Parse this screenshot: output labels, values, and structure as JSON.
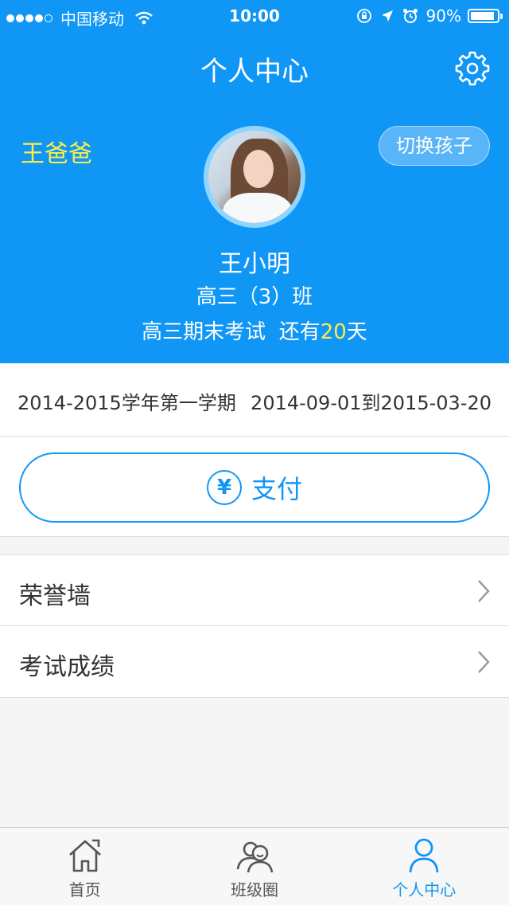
{
  "status_bar": {
    "carrier": "中国移动",
    "time": "10:00",
    "battery_text": "90%",
    "battery_level": 0.9,
    "icons": [
      "signal-dots-icon",
      "wifi-icon",
      "orientation-lock-icon",
      "location-arrow-icon",
      "alarm-icon",
      "battery-icon"
    ]
  },
  "header": {
    "title": "个人中心",
    "settings_icon": "gear-icon",
    "parent_name": "王爸爸",
    "switch_child_label": "切换孩子",
    "child_name": "王小明",
    "child_class": "高三（3）班",
    "countdown_prefix": "高三期末考试  还有",
    "countdown_days": "20",
    "countdown_suffix": "天"
  },
  "term": {
    "name": "2014-2015学年第一学期",
    "date_range": "2014-09-01到2015-03-20"
  },
  "pay": {
    "icon": "yen-icon",
    "icon_glyph": "¥",
    "label": "支付"
  },
  "menu": {
    "items": [
      {
        "label": "荣誉墙",
        "icon": "chevron-right-icon"
      },
      {
        "label": "考试成绩",
        "icon": "chevron-right-icon"
      }
    ]
  },
  "tab_bar": {
    "tabs": [
      {
        "label": "首页",
        "icon": "home-icon",
        "active": false
      },
      {
        "label": "班级圈",
        "icon": "group-icon",
        "active": false
      },
      {
        "label": "个人中心",
        "icon": "person-icon",
        "active": true
      }
    ]
  },
  "colors": {
    "brand_blue": "#1096f5",
    "highlight_yellow": "#ffee45",
    "background": "#f5f5f5"
  }
}
